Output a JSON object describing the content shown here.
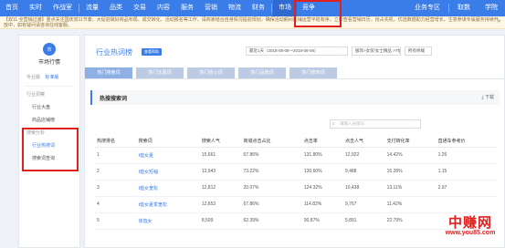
{
  "topnav": {
    "items": [
      {
        "label": "首页"
      },
      {
        "label": "实时"
      },
      {
        "label": "作战室"
      },
      {
        "label": "流量"
      },
      {
        "label": "品类"
      },
      {
        "label": "交易"
      },
      {
        "label": "内容"
      },
      {
        "label": "服务"
      },
      {
        "label": "营销"
      },
      {
        "label": "物流"
      },
      {
        "label": "财务"
      },
      {
        "label": "市场"
      },
      {
        "label": "竞争"
      },
      {
        "label": "业务专区"
      },
      {
        "label": "取数"
      },
      {
        "label": "学院"
      }
    ],
    "active_label": "市场"
  },
  "notice": {
    "text": "【双11 全营销过渡】重点关注国庆双11节奏，大促前做好商品布局、成交转化、活动报名等工作，请商家结合自身情况提前规划，确保活动期间店铺运营平稳有序。立即查看营销日历，抢占先机，优选数据助力经营增长。生意参谋专属服务持续开放中，如有疑问请咨询在线客服。"
  },
  "sidebar": {
    "logo_text": "市",
    "title": "市场行情",
    "mode_label": "专业版",
    "mode_tag": "标准版",
    "group1": "行业洞察",
    "items1": [
      "行业大盘",
      "商品店铺榜"
    ],
    "group2": "搜索分析",
    "items2": [
      "行业热搜词",
      "搜索词查询"
    ]
  },
  "main": {
    "title": "行业热词榜",
    "help": "查看帮助",
    "date_range": "最近1天（2018-08-08～2018-08-08）",
    "category": "服饰>女装/女士精品 >T恤",
    "platform": "所有终端",
    "tabs": [
      "热门搜索词",
      "热门长尾词",
      "热门核心词",
      "热门品牌词",
      "热门修饰词"
    ],
    "section_title": "热搜搜索词",
    "download": "下载",
    "search_placeholder": "请输入关键词"
  },
  "table": {
    "headers": [
      "热搜排名",
      "搜索词",
      "搜索人气",
      "商城点击占比",
      "点击率",
      "点击人气",
      "支付转化率",
      "直通车参考价"
    ],
    "rows": [
      [
        "1",
        "t恤女夏",
        "15,661",
        "57.86%",
        "131.80%",
        "12,922",
        "14.42%",
        "1.26"
      ],
      [
        "2",
        "t恤女短袖",
        "12,943",
        "73.22%",
        "120.60%",
        "9,488",
        "15.28%",
        "1.15"
      ],
      [
        "3",
        "t恤女宽松",
        "12,812",
        "20.07%",
        "124.32%",
        "10,438",
        "13.11%",
        "2.97"
      ],
      [
        "4",
        "t恤女夏季宽松",
        "12,653",
        "67.86%",
        "114.82%",
        "9,767",
        "11.42%",
        ""
      ],
      [
        "5",
        "体恤女",
        "8,509",
        "62.39%",
        "90.87%",
        "5,891",
        "22.79%",
        ""
      ]
    ]
  },
  "watermark": {
    "cn": "中赚网",
    "url": "www.you85.com"
  },
  "colors": {
    "nav_blue": "#3a7de8",
    "annotation_red": "#e02020",
    "tab_inactive": "#bccbe3",
    "tab_active": "#8fb0e4"
  }
}
